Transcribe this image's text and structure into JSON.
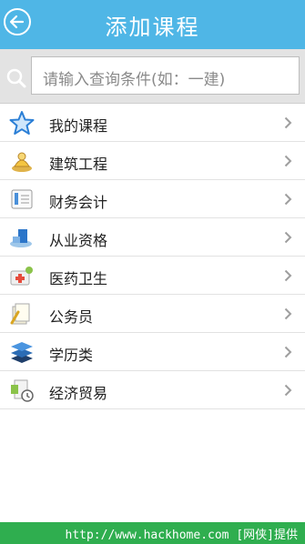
{
  "header": {
    "title": "添加课程"
  },
  "search": {
    "placeholder": "请输入查询条件(如：一建)"
  },
  "categories": [
    {
      "label": "我的课程",
      "icon": "star-icon"
    },
    {
      "label": "建筑工程",
      "icon": "construction-icon"
    },
    {
      "label": "财务会计",
      "icon": "calculator-icon"
    },
    {
      "label": "从业资格",
      "icon": "certificate-icon"
    },
    {
      "label": "医药卫生",
      "icon": "medical-kit-icon"
    },
    {
      "label": "公务员",
      "icon": "documents-icon"
    },
    {
      "label": "学历类",
      "icon": "layers-icon"
    },
    {
      "label": "经济贸易",
      "icon": "trade-icon"
    }
  ],
  "footer": {
    "watermark": "http://www.hackhome.com [网侠]提供"
  },
  "colors": {
    "header": "#4fb6e6",
    "footer": "#2fae4f"
  }
}
